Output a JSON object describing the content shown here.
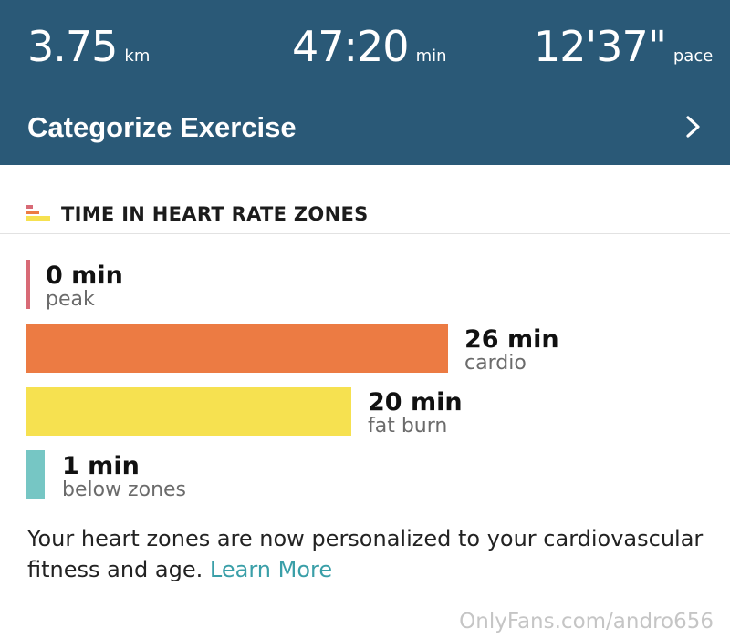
{
  "stats": {
    "distance_value": "3.75",
    "distance_unit": "km",
    "duration_value": "47:20",
    "duration_unit": "min",
    "pace_value": "12'37\"",
    "pace_unit": "pace"
  },
  "categorize": {
    "label": "Categorize Exercise",
    "icon": "chevron-right-icon"
  },
  "section": {
    "title": "TIME IN HEART RATE ZONES",
    "icon": "heart-zones-icon"
  },
  "zones": [
    {
      "value": "0 min",
      "label": "peak",
      "minutes": 0,
      "color": "#d86a76"
    },
    {
      "value": "26 min",
      "label": "cardio",
      "minutes": 26,
      "color": "#ec7b43"
    },
    {
      "value": "20 min",
      "label": "fat burn",
      "minutes": 20,
      "color": "#f6e150"
    },
    {
      "value": "1 min",
      "label": "below zones",
      "minutes": 1,
      "color": "#76c6c4"
    }
  ],
  "note": {
    "text": "Your heart zones are now personalized to your cardiovascular fitness and age.",
    "link": "Learn More"
  },
  "watermark": "OnlyFans.com/andro656",
  "colors": {
    "header_bg": "#2a5977",
    "link": "#3a9fa8"
  }
}
